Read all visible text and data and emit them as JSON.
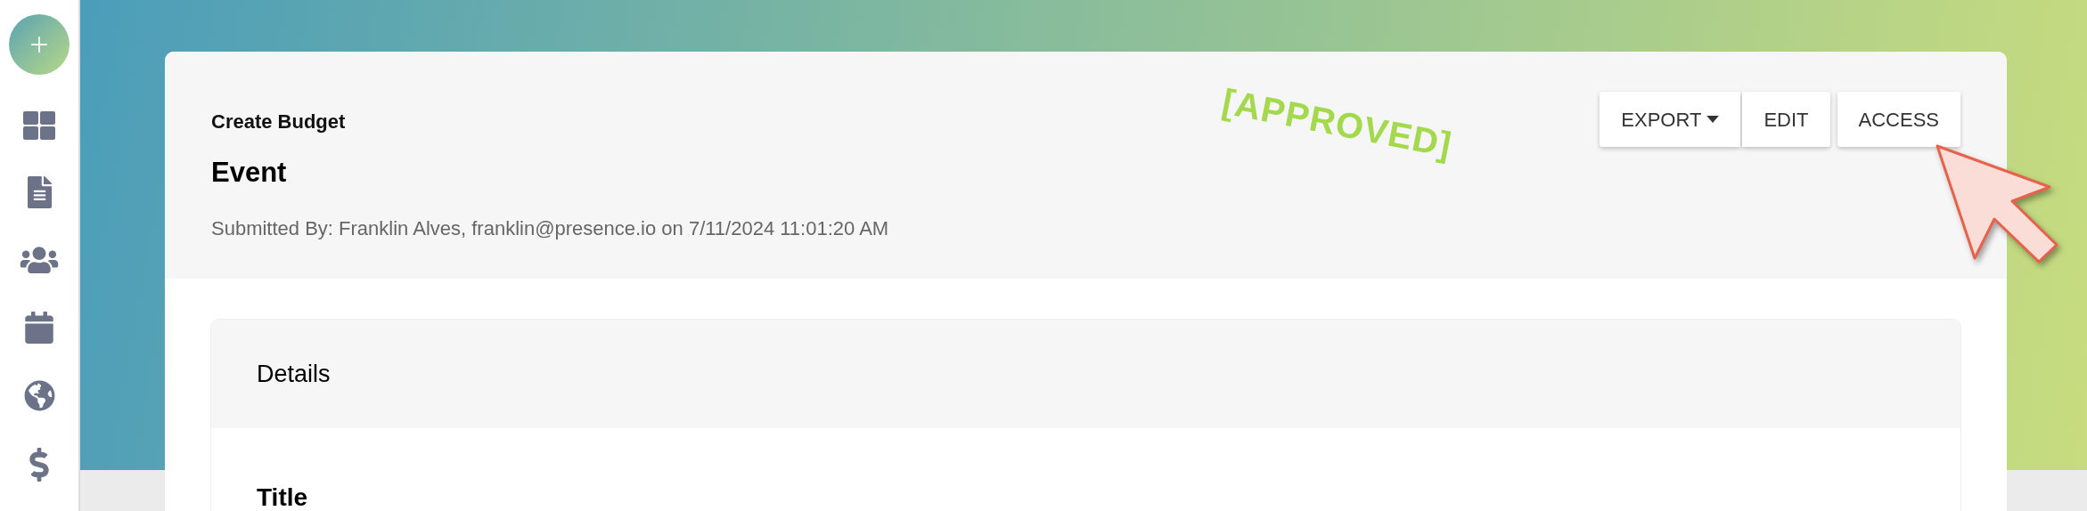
{
  "header": {
    "breadcrumb": "Create Budget",
    "title": "Event",
    "submitted": "Submitted By: Franklin Alves, franklin@presence.io on 7/11/2024 11:01:20 AM",
    "stamp": "[APPROVED]",
    "buttons": [
      {
        "label": "EXPORT",
        "kind": "dropdown"
      },
      {
        "label": "EDIT",
        "kind": "plain"
      },
      {
        "label": "ACCESS",
        "kind": "plain"
      }
    ]
  },
  "details": {
    "heading": "Details",
    "fields": [
      {
        "label": "Title"
      }
    ]
  }
}
